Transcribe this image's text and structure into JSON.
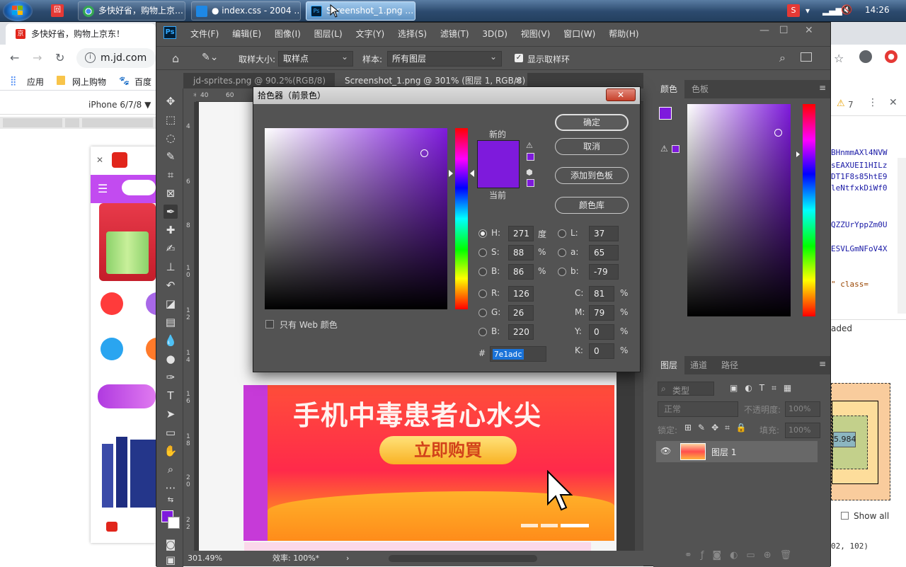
{
  "taskbar": {
    "apps": [
      {
        "title": "多快好省，购物上京…",
        "icon_color": "#4caf50"
      },
      {
        "title": "● index.css - 2004 …",
        "icon_color": "#1e88e5"
      },
      {
        "title": "Screenshot_1.png …",
        "icon_color": "#31a8ff"
      }
    ],
    "clock": "14:26"
  },
  "chrome": {
    "tab_title": "多快好省，购物上京东！",
    "url": "m.jd.com",
    "bookmarks": {
      "apps": "应用",
      "shopping": "网上购物",
      "baidu": "百度"
    },
    "device": "iPhone 6/7/8 ▼"
  },
  "devtools": {
    "warning_count": "7",
    "code_lines": [
      "BHnmmAXl4NVW",
      "sEAXUEI1HILz",
      "DT1F8s85htE9",
      "leNtfxkDiWf0",
      "QZZUrYppZm0U",
      "ESVLGmNFoV4X",
      "\" class="
    ],
    "loaded_text": "aded",
    "box_value": "5.984",
    "show_all": "Show all",
    "coords": "02, 102)"
  },
  "photoshop": {
    "menu": [
      "文件(F)",
      "编辑(E)",
      "图像(I)",
      "图层(L)",
      "文字(Y)",
      "选择(S)",
      "滤镜(T)",
      "3D(D)",
      "视图(V)",
      "窗口(W)",
      "帮助(H)"
    ],
    "options": {
      "sample_size_label": "取样大小:",
      "sample_size_value": "取样点",
      "sample_label": "样本:",
      "sample_value": "所有图层",
      "show_ring": "显示取样环"
    },
    "doc_tabs": [
      "jd-sprites.png @ 90.2%(RGB/8) *",
      "Screenshot_1.png @ 301% (图层 1, RGB/8)"
    ],
    "ruler_h": [
      "40",
      "60"
    ],
    "ruler_v": [
      "4",
      "6",
      "8",
      "1 0",
      "1 2",
      "1 4",
      "1 6",
      "1 8",
      "2 0",
      "2 2"
    ],
    "status": {
      "zoom": "301.49%",
      "efficiency": "效率: 100%*"
    },
    "panels": {
      "color_tabs": [
        "颜色",
        "色板"
      ],
      "layer_tabs": [
        "图层",
        "通道",
        "路径"
      ],
      "filter_placeholder": "类型",
      "blend_mode": "正常",
      "opacity_label": "不透明度:",
      "opacity_value": "100%",
      "lock_label": "锁定:",
      "fill_label": "填充:",
      "fill_value": "100%",
      "layer_name": "图层 1"
    },
    "banner": {
      "title": "手机中毒患者心水尖",
      "button": "立即购買"
    }
  },
  "picker": {
    "title": "拾色器（前景色）",
    "new_label": "新的",
    "current_label": "当前",
    "color": "#7e1adc",
    "buttons": {
      "ok": "确定",
      "cancel": "取消",
      "add": "添加到色板",
      "library": "颜色库"
    },
    "web_only": "只有 Web 颜色",
    "hsb": {
      "h": "271",
      "s": "88",
      "b": "86",
      "h_unit": "度",
      "pct": "%"
    },
    "rgb": {
      "r": "126",
      "g": "26",
      "b": "220"
    },
    "lab": {
      "l": "37",
      "a": "65",
      "b": "-79"
    },
    "cmyk": {
      "c": "81",
      "m": "79",
      "y": "0",
      "k": "0"
    },
    "hex": "7e1adc"
  }
}
